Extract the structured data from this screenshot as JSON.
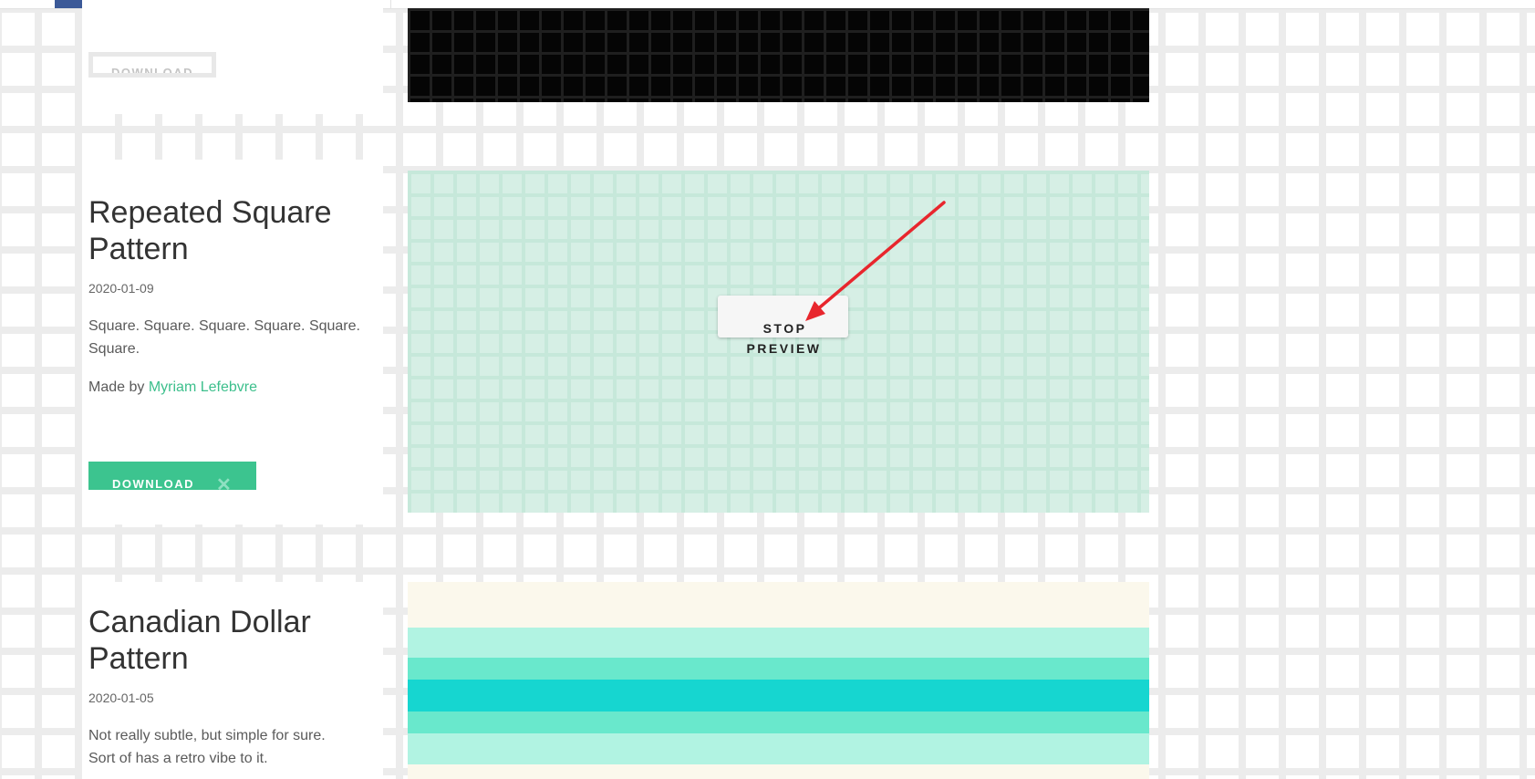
{
  "items": [
    {
      "download_label": "DOWNLOAD"
    },
    {
      "title_line1": "Repeated Square",
      "title_line2": "Pattern",
      "date": "2020-01-09",
      "description_line1": "Square. Square. Square. Square. Square.",
      "description_line2": "Square.",
      "credit_prefix": "Made by",
      "author": "Myriam Lefebvre",
      "download_label": "DOWNLOAD",
      "preview_button_line1": "STOP",
      "preview_button_line2": "PREVIEW",
      "preview_color": "#d6efe5"
    },
    {
      "title_line1": "Canadian Dollar",
      "title_line2": "Pattern",
      "date": "2020-01-05",
      "description_line1": "Not really subtle, but simple for sure.",
      "description_line2": "Sort of has a retro vibe to it."
    }
  ],
  "colors": {
    "accent_green": "#3cc48f",
    "link_green": "#3cbf8c",
    "nav_active": "#3b5998",
    "annotation_arrow": "#e8262d"
  }
}
